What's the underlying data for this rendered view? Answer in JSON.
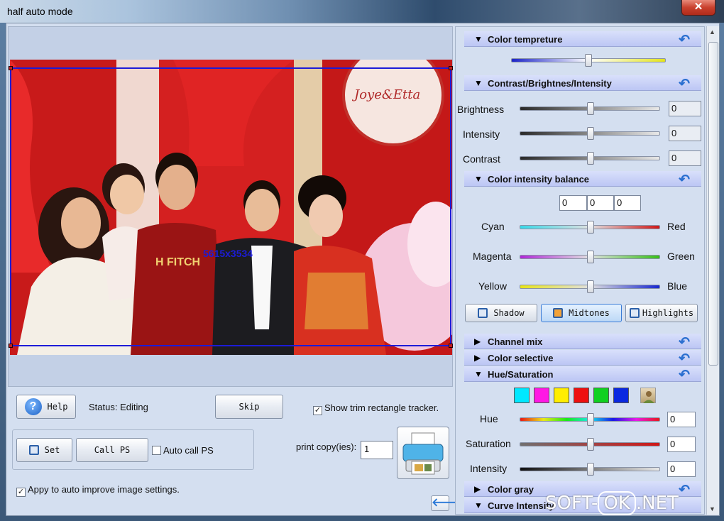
{
  "window": {
    "title": "half auto mode",
    "close_glyph": "✕"
  },
  "canvas": {
    "size_label": "5615x3534"
  },
  "left": {
    "help_label": "Help",
    "status_text": "Status: Editing",
    "skip_label": "Skip",
    "show_tracker_label": "Show trim rectangle tracker.",
    "show_tracker_checked": true,
    "set_label": "Set",
    "call_ps_label": "Call PS",
    "auto_call_ps_label": "Auto call PS",
    "auto_call_ps_checked": false,
    "print_copies_label": "print copy(ies):",
    "print_copies_value": "1",
    "auto_improve_label": "Appy to auto improve image settings.",
    "auto_improve_checked": true
  },
  "right": {
    "sections": {
      "color_temp": "Color tempreture",
      "contrast": "Contrast/Brightnes/Intensity",
      "color_balance": "Color intensity balance",
      "channel_mix": "Channel mix",
      "color_selective": "Color selective",
      "hue_sat": "Hue/Saturation",
      "color_gray": "Color gray",
      "curve": "Curve Intensity"
    },
    "contrast_rows": [
      {
        "label": "Brightness",
        "value": "0"
      },
      {
        "label": "Intensity",
        "value": "0"
      },
      {
        "label": "Contrast",
        "value": "0"
      }
    ],
    "balance_values": [
      "0",
      "0",
      "0"
    ],
    "balance_rows": [
      {
        "left": "Cyan",
        "right": "Red"
      },
      {
        "left": "Magenta",
        "right": "Green"
      },
      {
        "left": "Yellow",
        "right": "Blue"
      }
    ],
    "tone_buttons": [
      "Shadow",
      "Midtones",
      "Highlights"
    ],
    "selected_tone": "Midtones",
    "swatches": [
      "#00e8ff",
      "#ff18e4",
      "#ffee00",
      "#ee1010",
      "#10d020",
      "#0a28e0"
    ],
    "hue_rows": [
      {
        "label": "Hue",
        "value": "0"
      },
      {
        "label": "Saturation",
        "value": "0"
      },
      {
        "label": "Intensity",
        "value": "0"
      }
    ]
  },
  "watermark": {
    "left": "SOFT-",
    "ok": "OK",
    "right": ".NET"
  },
  "colors": {
    "accent_blue": "#1c1cd8",
    "section_header": "#c4cdf6",
    "reset_arrow": "#2a6fd0"
  }
}
